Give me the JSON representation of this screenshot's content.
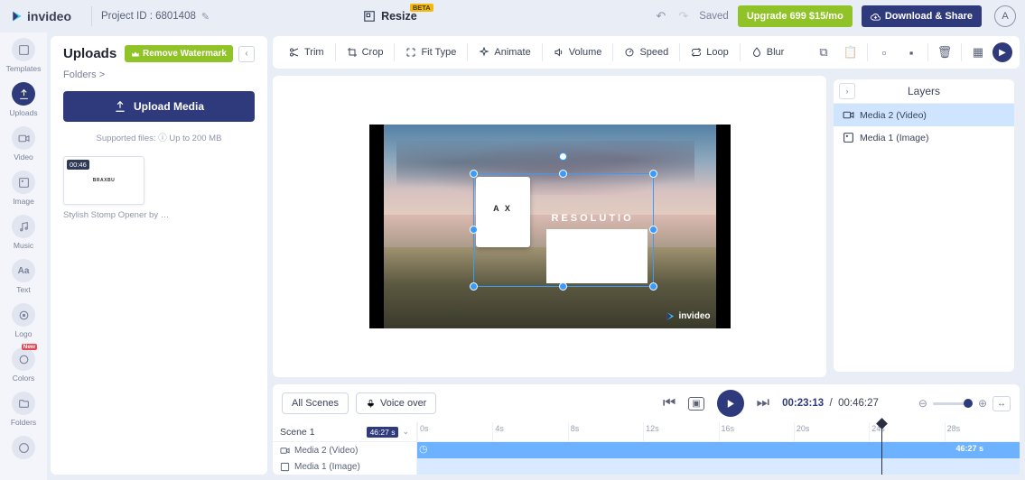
{
  "brand": "invideo",
  "project_id_label": "Project ID : 6801408",
  "resize_label": "Resize",
  "beta": "BETA",
  "saved": "Saved",
  "upgrade": "Upgrade 699 $15/mo",
  "download": "Download & Share",
  "avatar": "A",
  "rail": [
    {
      "label": "Templates"
    },
    {
      "label": "Uploads"
    },
    {
      "label": "Video"
    },
    {
      "label": "Image"
    },
    {
      "label": "Music"
    },
    {
      "label": "Text"
    },
    {
      "label": "Logo"
    },
    {
      "label": "Colors"
    },
    {
      "label": "Folders"
    },
    {
      "label": ""
    }
  ],
  "rail_new": "New",
  "sidepanel": {
    "title": "Uploads",
    "remove_wm": "Remove Watermark",
    "folders": "Folders >",
    "upload": "Upload Media",
    "supported": "Supported files: ⓘ  Up to 200 MB",
    "thumb_duration": "00:46",
    "thumb_text": "BRAXBU",
    "thumb_caption": "Stylish Stomp Opener by …"
  },
  "toolbar": {
    "trim": "Trim",
    "crop": "Crop",
    "fit": "Fit Type",
    "animate": "Animate",
    "volume": "Volume",
    "speed": "Speed",
    "loop": "Loop",
    "blur": "Blur"
  },
  "canvas": {
    "watermark": "invideo",
    "inner_text": "A X",
    "resolution_text": "RESOLUTIO"
  },
  "layers": {
    "title": "Layers",
    "items": [
      "Media 2 (Video)",
      "Media 1 (Image)"
    ]
  },
  "timeline": {
    "all_scenes": "All Scenes",
    "voice": "Voice over",
    "current": "00:23:13",
    "total": "00:46:27",
    "scene": "Scene 1",
    "scene_dur": "46:27 s",
    "tracks": [
      "Media 2 (Video)",
      "Media 1 (Image)"
    ],
    "ticks": [
      "0s",
      "4s",
      "8s",
      "12s",
      "16s",
      "20s",
      "24s",
      "28s"
    ],
    "clip_label": "46:27 s"
  }
}
